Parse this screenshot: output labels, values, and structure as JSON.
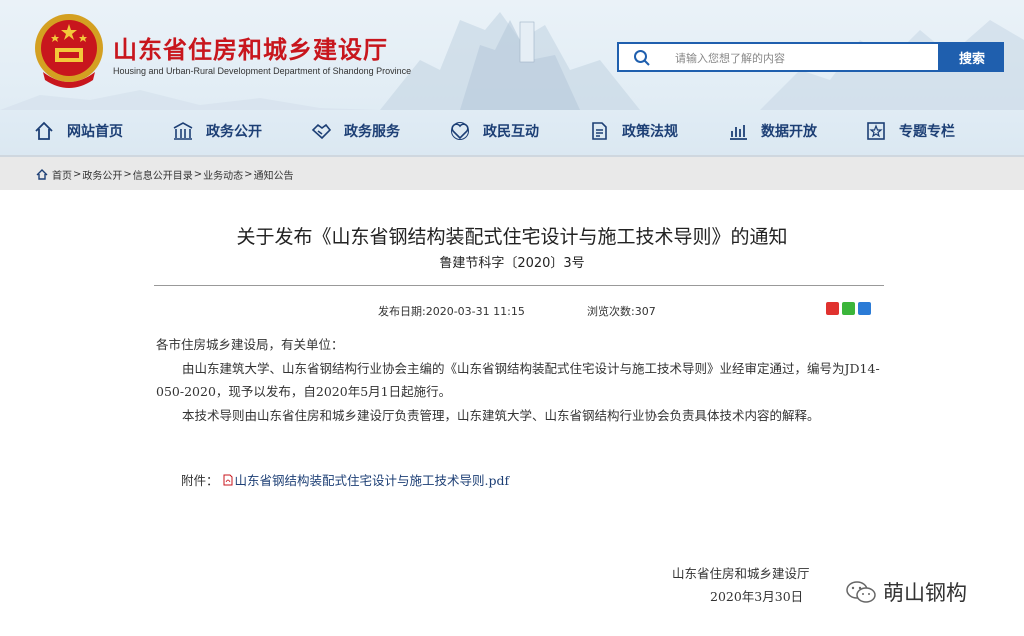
{
  "header": {
    "title": "山东省住房和城乡建设厅",
    "subtitle": "Housing and Urban-Rural Development Department of Shandong Province",
    "search_placeholder": "请输入您想了解的内容",
    "search_button": "搜索"
  },
  "nav": [
    {
      "label": "网站首页",
      "icon": "home-icon"
    },
    {
      "label": "政务公开",
      "icon": "building-icon"
    },
    {
      "label": "政务服务",
      "icon": "handshake-icon"
    },
    {
      "label": "政民互动",
      "icon": "heart-icon"
    },
    {
      "label": "政策法规",
      "icon": "document-icon"
    },
    {
      "label": "数据开放",
      "icon": "bar-chart-icon"
    },
    {
      "label": "专题专栏",
      "icon": "star-icon"
    }
  ],
  "breadcrumb": [
    "首页",
    "政务公开",
    "信息公开目录",
    "业务动态",
    "通知公告"
  ],
  "article": {
    "title": "关于发布《山东省钢结构装配式住宅设计与施工技术导则》的通知",
    "doc_number": "鲁建节科字〔2020〕3号",
    "publish_date": "发布日期:2020-03-31 11:15",
    "views": "浏览次数:307",
    "salutation": "各市住房城乡建设局，有关单位：",
    "para1": "由山东建筑大学、山东省钢结构行业协会主编的《山东省钢结构装配式住宅设计与施工技术导则》业经审定通过，编号为JD14-050-2020，现予以发布，自2020年5月1日起施行。",
    "para2": "本技术导则由山东省住房和城乡建设厅负责管理，山东建筑大学、山东省钢结构行业协会负责具体技术内容的解释。",
    "attachment_label": "附件：",
    "attachment_file": "山东省钢结构装配式住宅设计与施工技术导则.pdf",
    "signature_org": "山东省住房和城乡建设厅",
    "signature_date": "2020年3月30日"
  },
  "watermark": "萌山钢构",
  "colors": {
    "brand_red": "#c8161d",
    "nav_blue": "#1d3f75",
    "search_blue": "#1f5fae"
  }
}
